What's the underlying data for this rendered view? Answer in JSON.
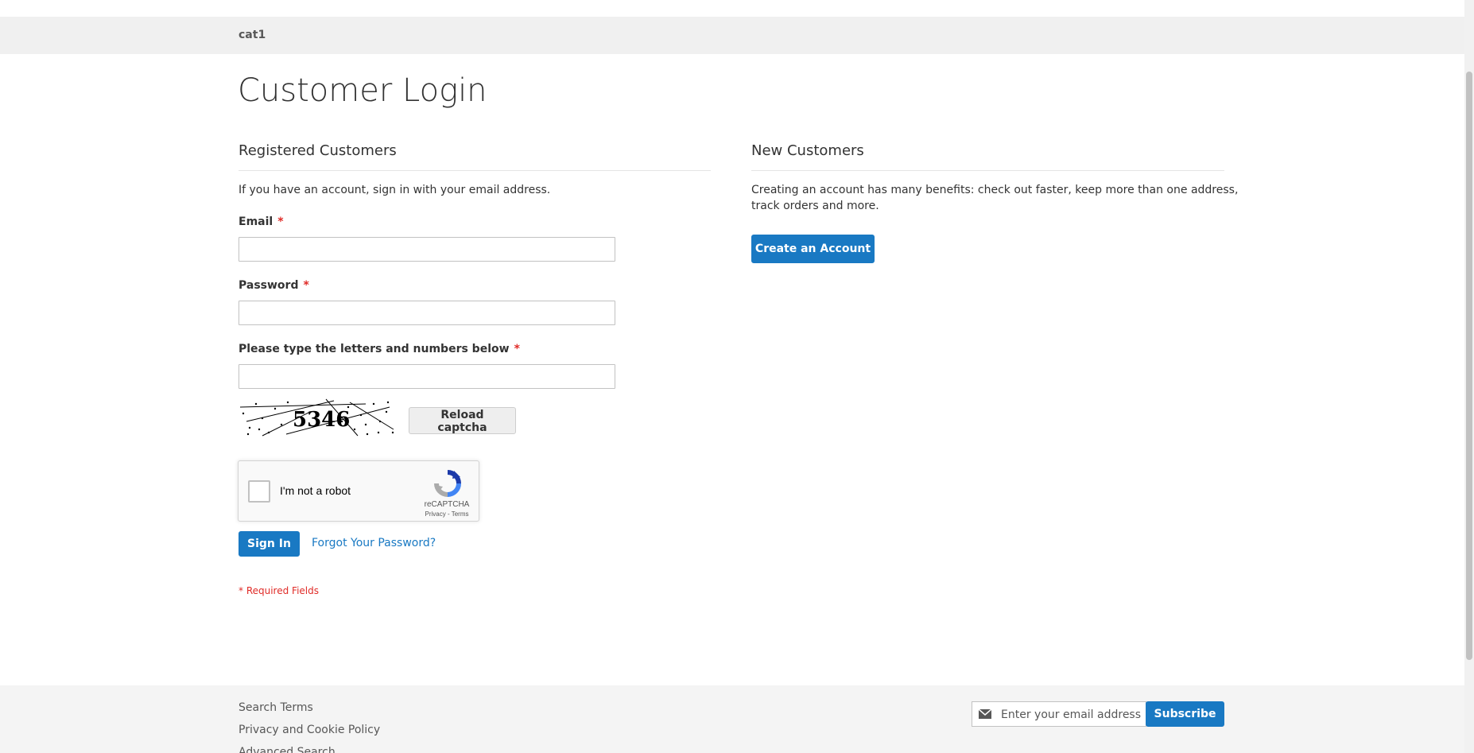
{
  "nav": {
    "category": "cat1"
  },
  "page": {
    "title": "Customer Login"
  },
  "registered": {
    "title": "Registered Customers",
    "intro": "If you have an account, sign in with your email address.",
    "email_label": "Email",
    "password_label": "Password",
    "captcha_label": "Please type the letters and numbers below",
    "required_mark": "*",
    "captcha_text": "5346",
    "reload_captcha": "Reload captcha",
    "recaptcha_label": "I'm not a robot",
    "recaptcha_brand": "reCAPTCHA",
    "recaptcha_links": "Privacy - Terms",
    "sign_in": "Sign In",
    "forgot_password": "Forgot Your Password?",
    "required_fields": "* Required Fields"
  },
  "new_customers": {
    "title": "New Customers",
    "text_line1": "Creating an account has many benefits: check out faster, keep more than one address,",
    "text_line2": "track orders and more.",
    "create_account": "Create an Account"
  },
  "footer": {
    "links": [
      "Search Terms",
      "Privacy and Cookie Policy",
      "Advanced Search"
    ],
    "newsletter_placeholder": "Enter your email address",
    "subscribe": "Subscribe"
  },
  "colors": {
    "primary": "#1979c3",
    "required": "#e02b27",
    "nav_bg": "#f0f0f0",
    "footer_bg": "#f4f4f4"
  }
}
